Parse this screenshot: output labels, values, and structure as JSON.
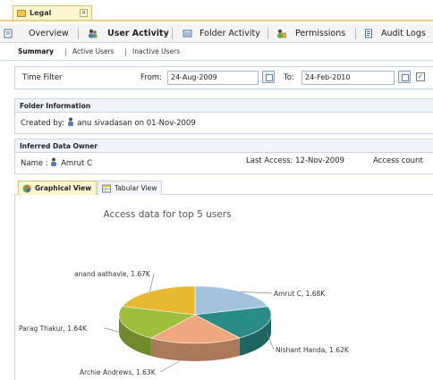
{
  "doc_tab": {
    "label": "Legal",
    "close": "×"
  },
  "main_tabs": [
    {
      "label": "Overview",
      "icon": "overview-icon"
    },
    {
      "label": "User Activity",
      "icon": "users-icon",
      "active": true
    },
    {
      "label": "Folder Activity",
      "icon": "folder-icon"
    },
    {
      "label": "Permissions",
      "icon": "permissions-icon"
    },
    {
      "label": "Audit Logs",
      "icon": "logs-icon"
    }
  ],
  "sub_tabs": [
    {
      "label": "Summary",
      "active": true
    },
    {
      "label": "Active Users"
    },
    {
      "label": "Inactive Users"
    }
  ],
  "time_filter": {
    "label": "Time Filter",
    "from_label": "From:",
    "from_value": "24-Aug-2009",
    "to_label": "To:",
    "to_value": "24-Feb-2010",
    "checkbox_checked": true
  },
  "folder_info": {
    "header": "Folder Information",
    "created_by_label": "Created by:",
    "created_by_user": "anu sivadasan",
    "created_on": "on 01-Nov-2009"
  },
  "owner_info": {
    "header": "Inferred Data Owner",
    "name_label": "Name :",
    "name_value": "Amrut C",
    "last_access": "Last Access: 12-Nov-2009",
    "access_count_label": "Access count"
  },
  "view_tabs": [
    {
      "label": "Graphical View",
      "active": true,
      "icon": "pie-chart-icon"
    },
    {
      "label": "Tabular View",
      "icon": "table-icon"
    }
  ],
  "colors": {
    "active_tab": "#fff6cf",
    "border": "#c6d4e4"
  },
  "chart_data": {
    "type": "pie",
    "style": "3d",
    "title": "Access data for top 5 users",
    "labels": [
      "Amrut C",
      "Nishant Handa",
      "Archie Andrews",
      "Parag Thakur",
      "anand aathavle"
    ],
    "values": [
      1.68,
      1.62,
      1.63,
      1.64,
      1.67
    ],
    "value_labels": [
      "1.68K",
      "1.62K",
      "1.63K",
      "1.64K",
      "1.67K"
    ],
    "colors": [
      "#a3c2de",
      "#2a8c87",
      "#efa77d",
      "#9dbf3c",
      "#e6b930"
    ]
  }
}
